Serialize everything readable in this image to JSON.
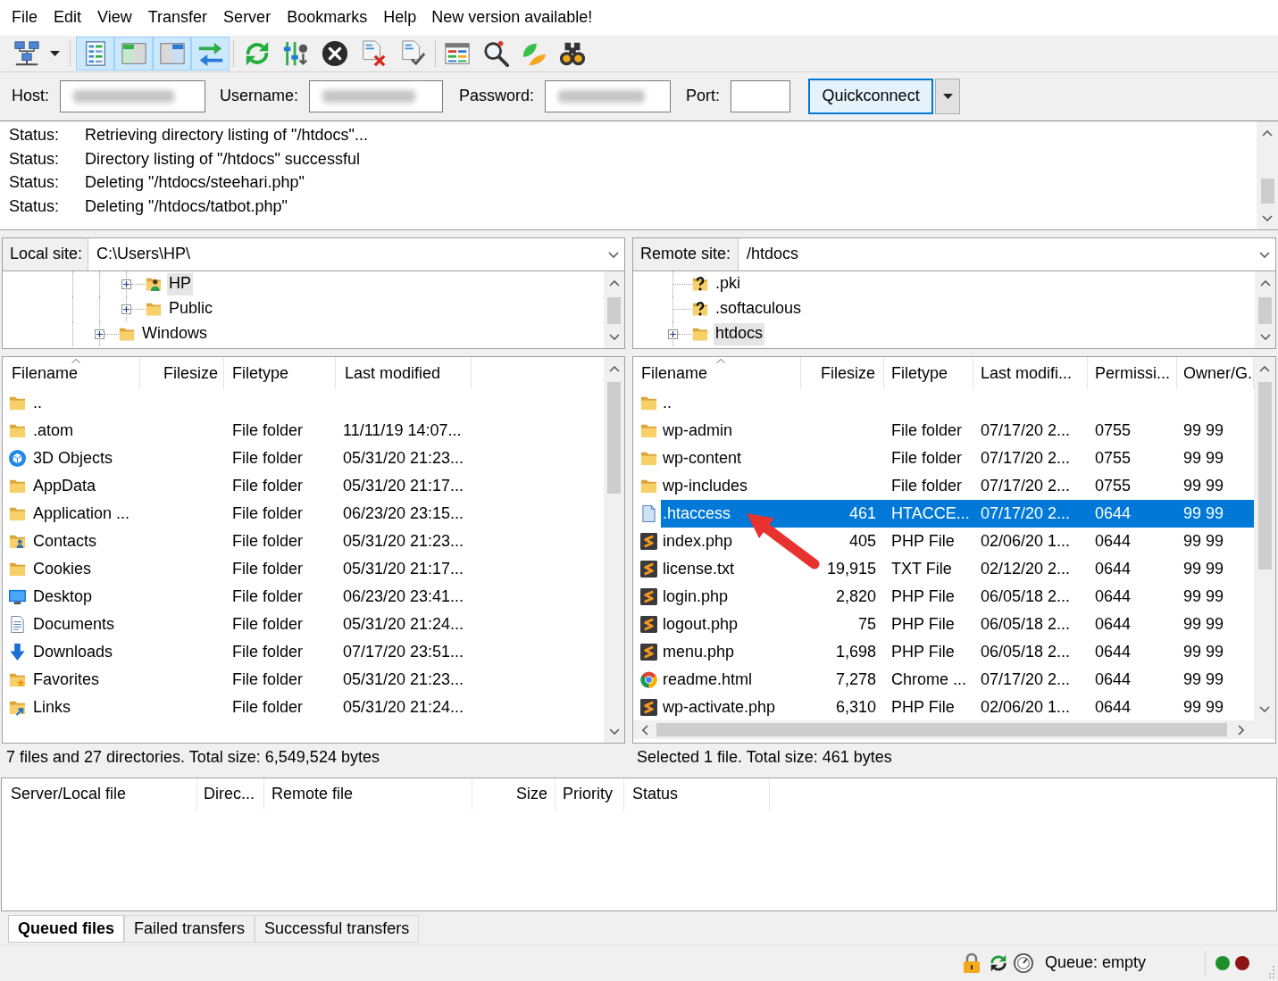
{
  "menu_bar": {
    "items": [
      "File",
      "Edit",
      "View",
      "Transfer",
      "Server",
      "Bookmarks",
      "Help"
    ],
    "notice": "New version available!"
  },
  "toolbar": {
    "toggles": [
      {
        "kind": "log",
        "on": true
      },
      {
        "kind": "localtree",
        "on": true
      },
      {
        "kind": "remotetree",
        "on": true
      },
      {
        "kind": "queue",
        "on": true
      }
    ]
  },
  "quickconnect": {
    "fields": [
      {
        "label": "Host:",
        "blurred": true
      },
      {
        "label": "Username:",
        "blurred": true
      },
      {
        "label": "Password:",
        "blurred": true
      },
      {
        "label": "Port:",
        "blurred": false
      }
    ],
    "button": "Quickconnect"
  },
  "message_log": [
    {
      "type": "Status:",
      "message": "Retrieving directory listing of \"/htdocs\"..."
    },
    {
      "type": "Status:",
      "message": "Directory listing of \"/htdocs\" successful"
    },
    {
      "type": "Status:",
      "message": "Deleting \"/htdocs/steehari.php\""
    },
    {
      "type": "Status:",
      "message": "Deleting \"/htdocs/tatbot.php\""
    }
  ],
  "local": {
    "site_label": "Local site:",
    "path": "C:\\Users\\HP\\",
    "tree": [
      {
        "children": [
          {
            "children": [
              {
                "label": "HP",
                "kind": "user",
                "expandable": true,
                "selected": true
              },
              {
                "label": "Public",
                "kind": "folder",
                "expandable": true,
                "selected": false
              }
            ]
          },
          {
            "label": "Windows",
            "kind": "folder",
            "expandable": true,
            "selected": false
          }
        ]
      }
    ],
    "columns": [
      {
        "label": "Filename",
        "sorted": true
      },
      {
        "label": "Filesize",
        "sorted": false
      },
      {
        "label": "Filetype",
        "sorted": false
      },
      {
        "label": "Last modified",
        "sorted": false
      }
    ],
    "rows": [
      {
        "kind": "folder",
        "name": "..",
        "selected": false
      },
      {
        "kind": "folder",
        "name": ".atom",
        "type": "File folder",
        "modified": "11/11/19 14:07...",
        "selected": false
      },
      {
        "kind": "objects3d",
        "name": "3D Objects",
        "type": "File folder",
        "modified": "05/31/20 21:23...",
        "selected": false
      },
      {
        "kind": "folder",
        "name": "AppData",
        "type": "File folder",
        "modified": "05/31/20 21:17...",
        "selected": false
      },
      {
        "kind": "folder",
        "name": "Application ...",
        "type": "File folder",
        "modified": "06/23/20 23:15...",
        "selected": false
      },
      {
        "kind": "contacts",
        "name": "Contacts",
        "type": "File folder",
        "modified": "05/31/20 21:23...",
        "selected": false
      },
      {
        "kind": "folder",
        "name": "Cookies",
        "type": "File folder",
        "modified": "05/31/20 21:17...",
        "selected": false
      },
      {
        "kind": "desktop",
        "name": "Desktop",
        "type": "File folder",
        "modified": "06/23/20 23:41...",
        "selected": false
      },
      {
        "kind": "documents",
        "name": "Documents",
        "type": "File folder",
        "modified": "05/31/20 21:24...",
        "selected": false
      },
      {
        "kind": "downloads",
        "name": "Downloads",
        "type": "File folder",
        "modified": "07/17/20 23:51...",
        "selected": false
      },
      {
        "kind": "favorites",
        "name": "Favorites",
        "type": "File folder",
        "modified": "05/31/20 21:23...",
        "selected": false
      },
      {
        "kind": "links",
        "name": "Links",
        "type": "File folder",
        "modified": "05/31/20 21:24...",
        "selected": false
      }
    ],
    "summary": "7 files and 27 directories. Total size: 6,549,524 bytes"
  },
  "remote": {
    "site_label": "Remote site:",
    "path": "/htdocs",
    "tree": [
      {
        "label": ".pki",
        "kind": "unknown",
        "expandable": false,
        "selected": false
      },
      {
        "label": ".softaculous",
        "kind": "unknown",
        "expandable": false,
        "selected": false
      },
      {
        "label": "htdocs",
        "kind": "folder",
        "expandable": true,
        "selected": true
      }
    ],
    "columns": [
      {
        "label": "Filename",
        "sorted": true
      },
      {
        "label": "Filesize",
        "sorted": false
      },
      {
        "label": "Filetype",
        "sorted": false
      },
      {
        "label": "Last modifi...",
        "sorted": false
      },
      {
        "label": "Permissi...",
        "sorted": false
      },
      {
        "label": "Owner/G.",
        "sorted": false
      }
    ],
    "rows": [
      {
        "kind": "folder",
        "name": "..",
        "selected": false
      },
      {
        "kind": "folder",
        "name": "wp-admin",
        "type": "File folder",
        "modified": "07/17/20 2...",
        "permissions": "0755",
        "owner": "99 99",
        "selected": false
      },
      {
        "kind": "folder",
        "name": "wp-content",
        "type": "File folder",
        "modified": "07/17/20 2...",
        "permissions": "0755",
        "owner": "99 99",
        "selected": false
      },
      {
        "kind": "folder",
        "name": "wp-includes",
        "type": "File folder",
        "modified": "07/17/20 2...",
        "permissions": "0755",
        "owner": "99 99",
        "selected": false
      },
      {
        "kind": "document",
        "name": ".htaccess",
        "size": "461",
        "type": "HTACCE...",
        "modified": "07/17/20 2...",
        "permissions": "0644",
        "owner": "99 99",
        "selected": true
      },
      {
        "kind": "script",
        "name": "index.php",
        "size": "405",
        "type": "PHP File",
        "modified": "02/06/20 1...",
        "permissions": "0644",
        "owner": "99 99",
        "selected": false
      },
      {
        "kind": "script",
        "name": "license.txt",
        "size": "19,915",
        "type": "TXT File",
        "modified": "02/12/20 2...",
        "permissions": "0644",
        "owner": "99 99",
        "selected": false
      },
      {
        "kind": "script",
        "name": "login.php",
        "size": "2,820",
        "type": "PHP File",
        "modified": "06/05/18 2...",
        "permissions": "0644",
        "owner": "99 99",
        "selected": false
      },
      {
        "kind": "script",
        "name": "logout.php",
        "size": "75",
        "type": "PHP File",
        "modified": "06/05/18 2...",
        "permissions": "0644",
        "owner": "99 99",
        "selected": false
      },
      {
        "kind": "script",
        "name": "menu.php",
        "size": "1,698",
        "type": "PHP File",
        "modified": "06/05/18 2...",
        "permissions": "0644",
        "owner": "99 99",
        "selected": false
      },
      {
        "kind": "chrome",
        "name": "readme.html",
        "size": "7,278",
        "type": "Chrome ...",
        "modified": "07/17/20 2...",
        "permissions": "0644",
        "owner": "99 99",
        "selected": false
      },
      {
        "kind": "script",
        "name": "wp-activate.php",
        "size": "6,310",
        "type": "PHP File",
        "modified": "02/06/20 1...",
        "permissions": "0644",
        "owner": "99 99",
        "selected": false
      }
    ],
    "summary": "Selected 1 file. Total size: 461 bytes"
  },
  "queue": {
    "columns": [
      "Server/Local file",
      "Direc...",
      "Remote file",
      "Size",
      "Priority",
      "Status"
    ],
    "tabs": [
      {
        "label": "Queued files",
        "selected": true
      },
      {
        "label": "Failed transfers",
        "selected": false
      },
      {
        "label": "Successful transfers",
        "selected": false
      }
    ]
  },
  "status_bar": {
    "queue": "Queue: empty",
    "indicators": [
      {
        "color": "#1f8f2a"
      },
      {
        "color": "#8e1414"
      }
    ]
  }
}
